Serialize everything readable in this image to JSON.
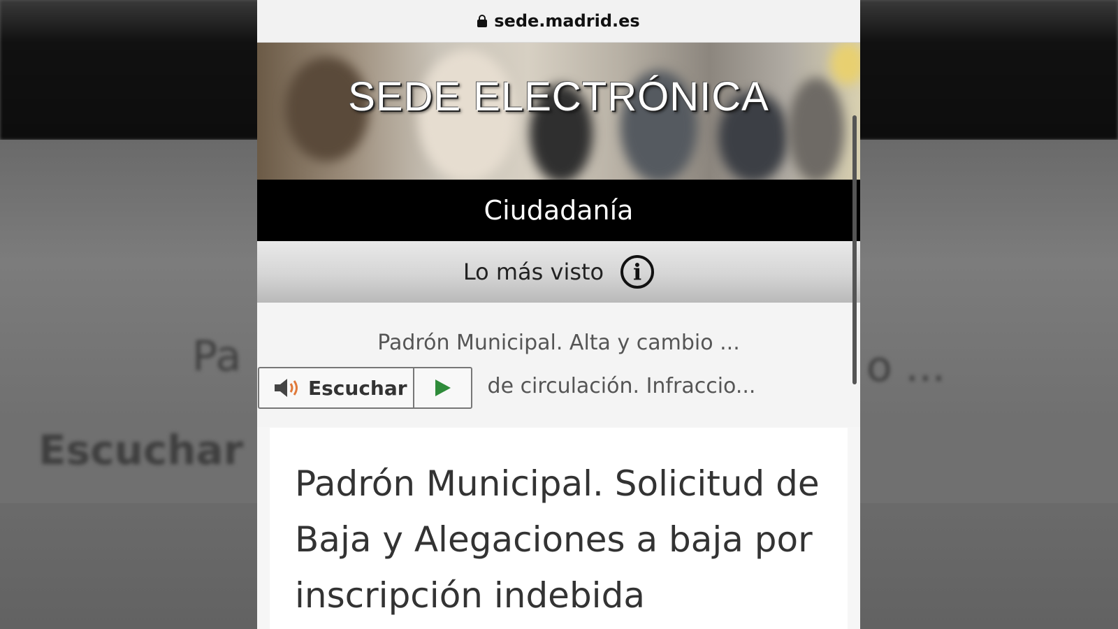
{
  "browser": {
    "url": "sede.madrid.es"
  },
  "header": {
    "title": "SEDE ELECTRÓNICA",
    "section": "Ciudadanía"
  },
  "most_viewed": {
    "label": "Lo más visto",
    "items": [
      "Padrón Municipal. Alta y cambio ...",
      "de circulación. Infraccio..."
    ]
  },
  "listen": {
    "label": "Escuchar"
  },
  "article": {
    "title": "Padrón Municipal. Solicitud de Baja y Alegaciones a baja por inscripción indebida"
  },
  "colors": {
    "section_bar": "#000000",
    "play": "#2e8b3a",
    "speaker_waves": "#e0793a"
  }
}
